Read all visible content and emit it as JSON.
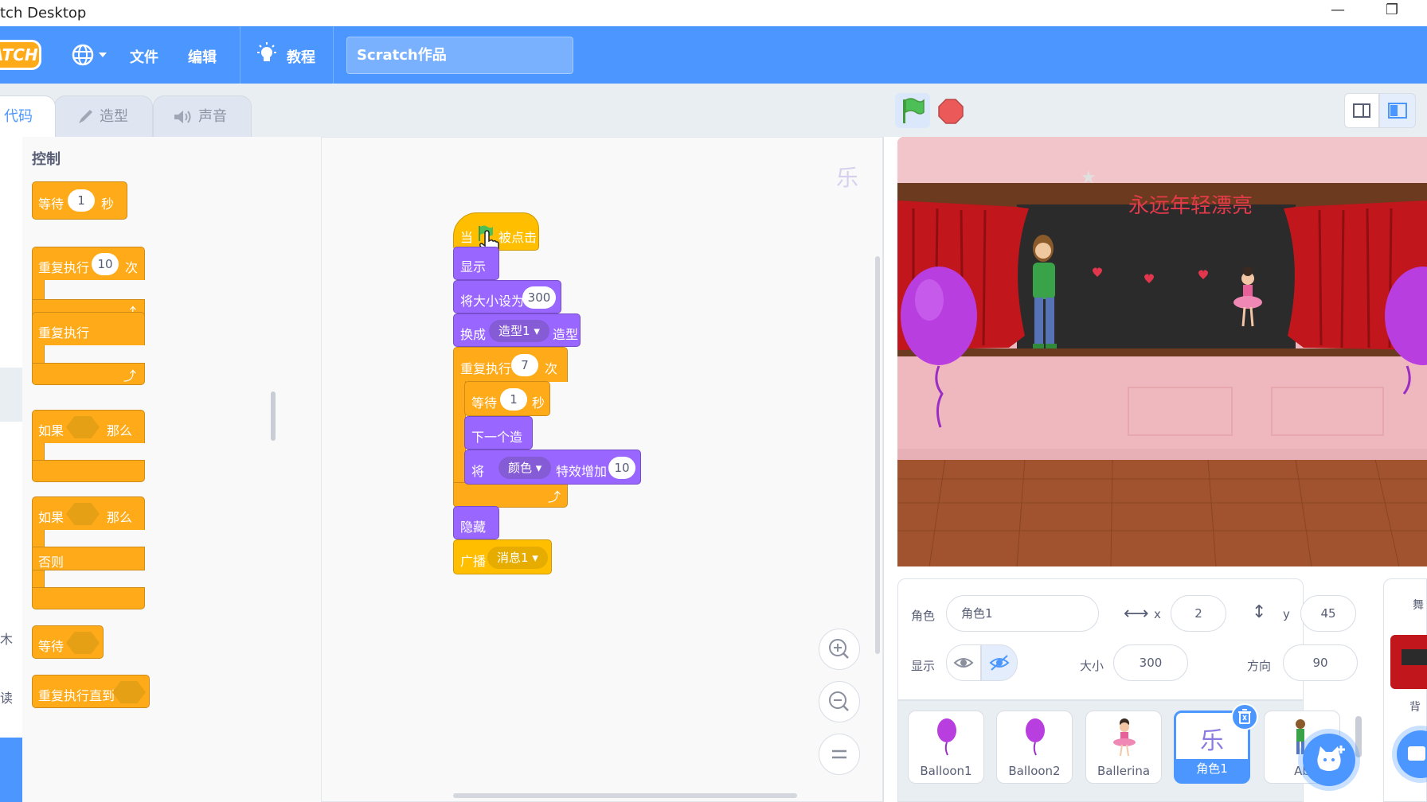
{
  "window": {
    "title": "tch Desktop",
    "minimize": "—",
    "restore": "❐"
  },
  "menubar": {
    "logo_text": "ATCH",
    "language_icon": "globe-icon",
    "file": "文件",
    "edit": "编辑",
    "tutorials": "教程",
    "project_title": "Scratch作品"
  },
  "tabs": {
    "code": "代码",
    "costumes": "造型",
    "sounds": "声音"
  },
  "palette": {
    "category_title": "控制",
    "wait_label": "等待",
    "wait_value": "1",
    "wait_unit": "秒",
    "repeat_label": "重复执行",
    "repeat_value": "10",
    "repeat_unit": "次",
    "forever_label": "重复执行",
    "if_label": "如果",
    "then_label": "那么",
    "if2_label": "如果",
    "then2_label": "那么",
    "else_label": "否则",
    "wait_until_label": "等待",
    "repeat_until_label": "重复执行直到",
    "side_char_1": "木",
    "side_char_2": "读"
  },
  "script": {
    "hat_when": "当",
    "hat_clicked": "被点击",
    "show": "显示",
    "set_size_label": "将大小设为",
    "set_size_value": "300",
    "switch_label": "换成",
    "switch_value": "造型1",
    "switch_suffix": "造型",
    "repeat_label": "重复执行",
    "repeat_value": "7",
    "repeat_unit": "次",
    "wait_label": "等待",
    "wait_value": "1",
    "wait_unit": "秒",
    "next_costume": "下一个造型",
    "effect_prefix": "将",
    "effect_value": "颜色",
    "effect_label": "特效增加",
    "effect_amount": "10",
    "hide": "隐藏",
    "broadcast_label": "广播",
    "broadcast_value": "消息1",
    "sprite_watermark": "乐"
  },
  "stage": {
    "banner_text": "永远年轻漂亮"
  },
  "sprite_info": {
    "sprite_label": "角色",
    "sprite_name": "角色1",
    "x_label": "x",
    "x_value": "2",
    "y_label": "y",
    "y_value": "45",
    "show_label": "显示",
    "size_label": "大小",
    "size_value": "300",
    "direction_label": "方向",
    "direction_value": "90"
  },
  "sprites": [
    {
      "name": "Balloon1"
    },
    {
      "name": "Balloon2"
    },
    {
      "name": "Ballerina"
    },
    {
      "name": "角色1",
      "glyph": "乐"
    },
    {
      "name": "Ab"
    }
  ],
  "stage_panel": {
    "title": "舞",
    "backdrop_label": "背"
  }
}
